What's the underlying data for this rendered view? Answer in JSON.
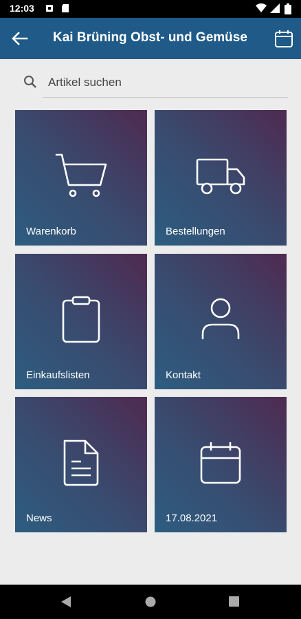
{
  "status_bar": {
    "time": "12:03"
  },
  "app_bar": {
    "title": "Kai Brüning Obst- und Gemüse"
  },
  "search": {
    "placeholder": "Artikel suchen"
  },
  "tiles": [
    {
      "label": "Warenkorb",
      "icon": "cart-icon"
    },
    {
      "label": "Bestellungen",
      "icon": "truck-icon"
    },
    {
      "label": "Einkaufslisten",
      "icon": "clipboard-icon"
    },
    {
      "label": "Kontakt",
      "icon": "person-icon"
    },
    {
      "label": "News",
      "icon": "document-icon"
    },
    {
      "label": "17.08.2021",
      "icon": "calendar-icon"
    }
  ],
  "colors": {
    "app_bar": "#1f5a88",
    "tile_gradient_start": "#2d5d80",
    "tile_gradient_end": "#4f2a50",
    "background": "#ececec"
  }
}
